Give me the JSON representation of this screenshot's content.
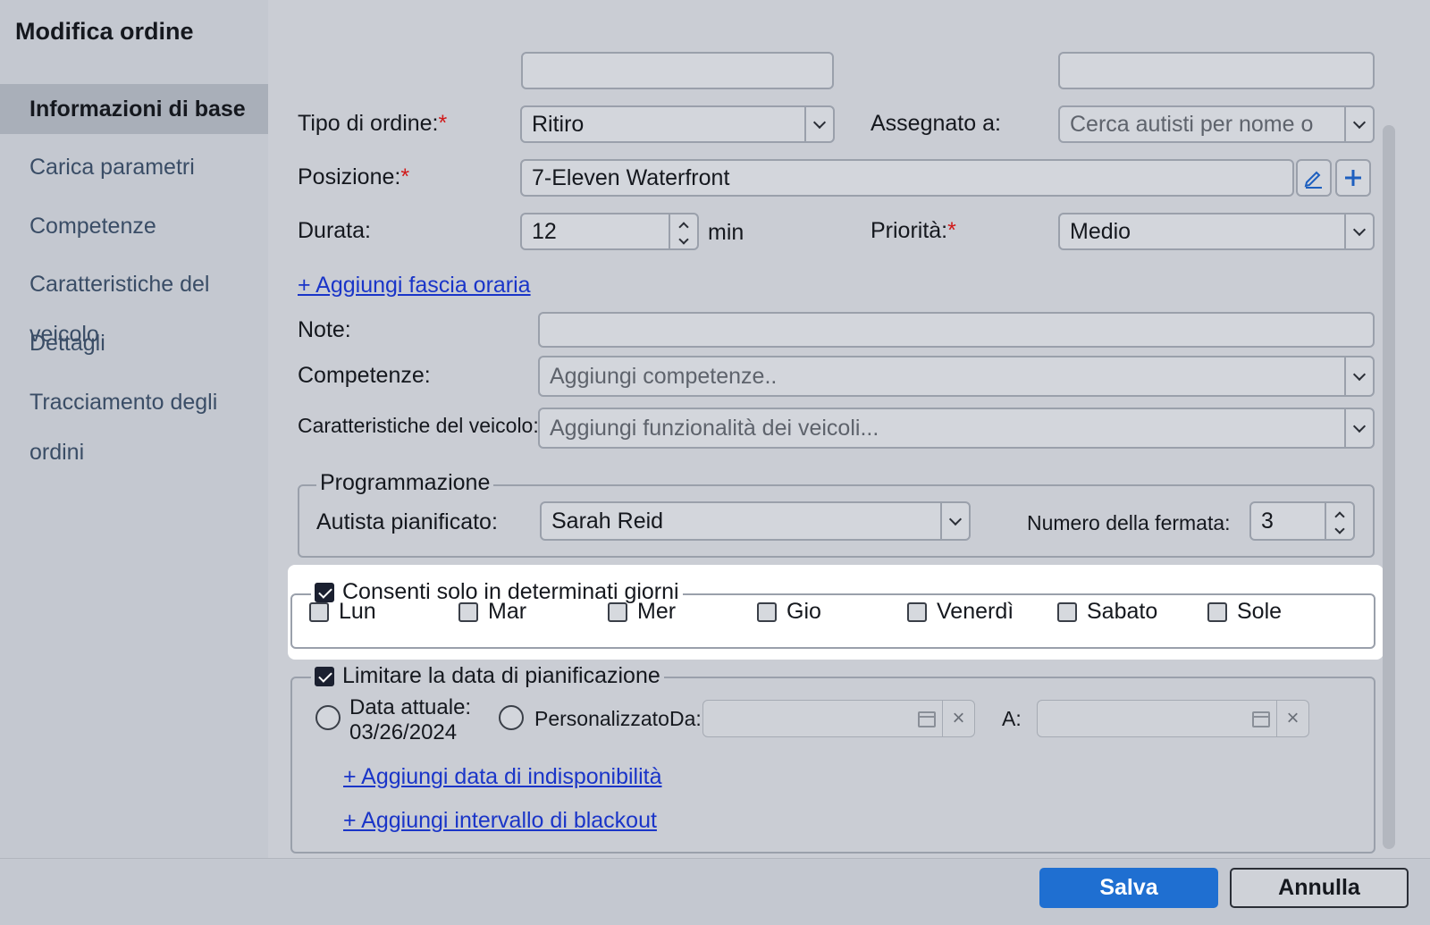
{
  "window": {
    "title": "Modifica ordine"
  },
  "sidebar": {
    "items": [
      {
        "label": "Informazioni di base",
        "active": true
      },
      {
        "label": "Carica parametri"
      },
      {
        "label": "Competenze"
      },
      {
        "label": "Caratteristiche del veicolo"
      },
      {
        "label": "Dettagli"
      },
      {
        "label": "Tracciamento degli ordini"
      }
    ]
  },
  "form": {
    "order_type": {
      "label": "Tipo di ordine:",
      "required_mark": "*",
      "value": "Ritiro"
    },
    "assigned": {
      "label": "Assegnato a:",
      "placeholder": "Cerca autisti per nome o"
    },
    "position": {
      "label": "Posizione:",
      "required_mark": "*",
      "value": "7-Eleven Waterfront"
    },
    "duration": {
      "label": "Durata:",
      "value": "12",
      "unit": "min"
    },
    "priority": {
      "label": "Priorità:",
      "required_mark": "*",
      "value": "Medio"
    },
    "add_time_slot_link": "+ Aggiungi fascia oraria",
    "notes": {
      "label": "Note:",
      "value": ""
    },
    "skills": {
      "label": "Competenze:",
      "placeholder": "Aggiungi competenze.."
    },
    "vehicle_features": {
      "label": "Caratteristiche del veicolo:",
      "placeholder": "Aggiungi funzionalità dei veicoli..."
    }
  },
  "scheduling": {
    "legend": "Programmazione",
    "planned_driver": {
      "label": "Autista pianificato:",
      "value": "Sarah Reid"
    },
    "stop_number": {
      "label": "Numero della fermata:",
      "value": "3"
    }
  },
  "allowed_days": {
    "legend": "Consenti solo in determinati giorni",
    "checked": true,
    "days": [
      {
        "label": "Lun",
        "checked": false
      },
      {
        "label": "Mar",
        "checked": false
      },
      {
        "label": "Mer",
        "checked": false
      },
      {
        "label": "Gio",
        "checked": false
      },
      {
        "label": "Venerdì",
        "checked": false
      },
      {
        "label": "Sabato",
        "checked": false
      },
      {
        "label": "Sole",
        "checked": false
      }
    ]
  },
  "date_limit": {
    "legend": "Limitare la data di pianificazione",
    "checked": true,
    "current_date_label": "Data attuale:",
    "current_date_value": "03/26/2024",
    "custom_label": "Personalizzato:",
    "from_label": "Da:",
    "to_label": "A:",
    "add_unavailability_link": "+ Aggiungi data di indisponibilità",
    "add_blackout_link": "+ Aggiungi intervallo di blackout"
  },
  "footer": {
    "save_label": "Salva",
    "cancel_label": "Annulla"
  },
  "colors": {
    "accent": "#1f6fd1",
    "required": "#d11919",
    "link": "#1a35c8"
  }
}
